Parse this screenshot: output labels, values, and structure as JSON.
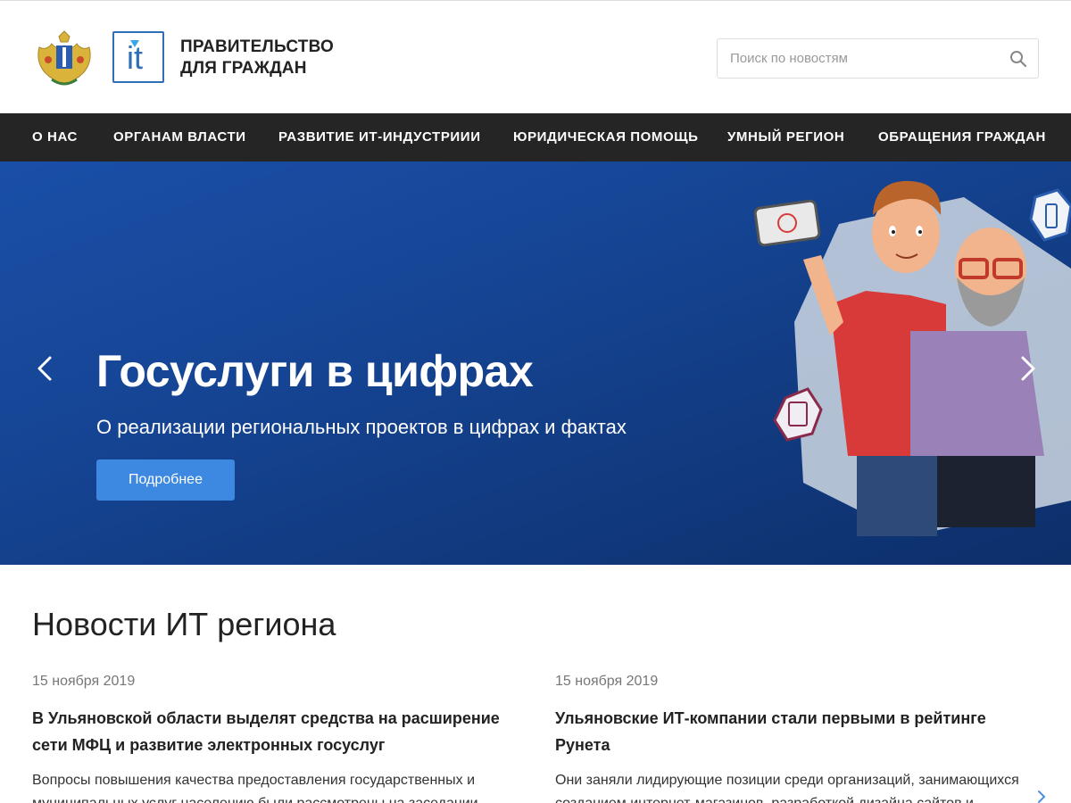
{
  "header": {
    "brand_line1": "ПРАВИТЕЛЬСТВО",
    "brand_line2": "ДЛЯ ГРАЖДАН",
    "logo_text": "it",
    "search_placeholder": "Поиск по новостям"
  },
  "nav": {
    "items": [
      {
        "label": "О НАС"
      },
      {
        "label": "ОРГАНАМ ВЛАСТИ"
      },
      {
        "label": "РАЗВИТИЕ ИТ-ИНДУСТРИИИ"
      },
      {
        "label": "ЮРИДИЧЕСКАЯ ПОМОЩЬ"
      },
      {
        "label": "УМНЫЙ РЕГИОН"
      },
      {
        "label": "ОБРАЩЕНИЯ ГРАЖДАН"
      }
    ]
  },
  "hero": {
    "title": "Госуслуги в цифрах",
    "subtitle": "О реализации региональных проектов в цифрах и фактах",
    "button_label": "Подробнее",
    "prev_icon": "chevron-left-icon",
    "next_icon": "chevron-right-icon"
  },
  "news": {
    "title": "Новости ИТ региона",
    "items": [
      {
        "date": "15 ноября 2019",
        "headline": "В Ульяновской области выделят средства на расширение сети МФЦ и развитие электронных госуслуг",
        "text": "Вопросы повышения качества предоставления государственных и муниципальных услуг населению были рассмотрены на заседании"
      },
      {
        "date": "15 ноября 2019",
        "headline": "Ульяновские ИТ-компании стали первыми в рейтинге Рунета",
        "text": "Они заняли лидирующие позиции среди организаций, занимающихся созданием интернет-магазинов, разработкой дизайна сайтов и мобильных приложений, а также digital-агентств. Simtech Development"
      }
    ]
  },
  "colors": {
    "nav_bg": "#252525",
    "hero_bg": "#154493",
    "button_bg": "#3d88e0",
    "logo_blue": "#2f6fb5"
  }
}
